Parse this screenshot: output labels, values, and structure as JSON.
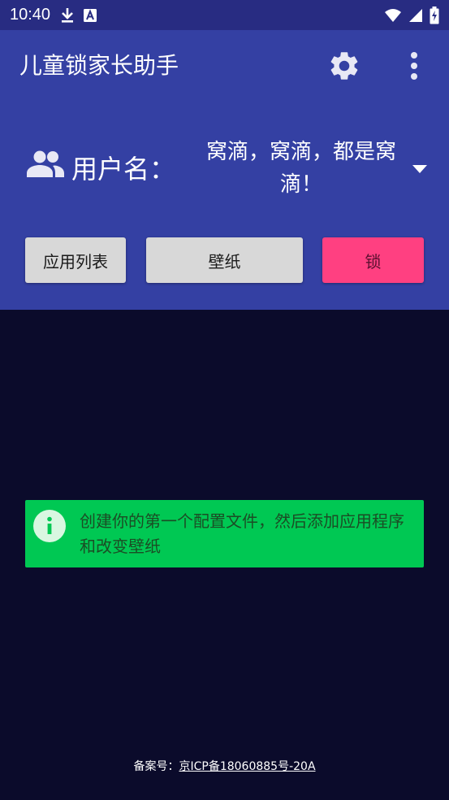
{
  "status_bar": {
    "time": "10:40",
    "icons_left": [
      "download-icon",
      "a-box-icon"
    ],
    "icons_right": [
      "wifi-icon",
      "signal-icon",
      "battery-charging-icon"
    ]
  },
  "header": {
    "title": "儿童锁家长助手",
    "settings_icon": "gear-icon",
    "menu_icon": "more-vert-icon",
    "background": "#3440a3"
  },
  "user": {
    "label": "用户名：",
    "selected": "窝滴，窝滴，都是窝滴！"
  },
  "buttons": {
    "apps": "应用列表",
    "wallpaper": "壁纸",
    "lock": "锁"
  },
  "colors": {
    "status_bar": "#282c82",
    "body_bg": "#0b0b2b",
    "lock_button": "#ff4081",
    "info_banner": "#00c853"
  },
  "info": {
    "text": "创建你的第一个配置文件，然后添加应用程序和改变壁纸"
  },
  "footer": {
    "label": "备案号：",
    "icp": "京ICP备18060885号-20A"
  }
}
